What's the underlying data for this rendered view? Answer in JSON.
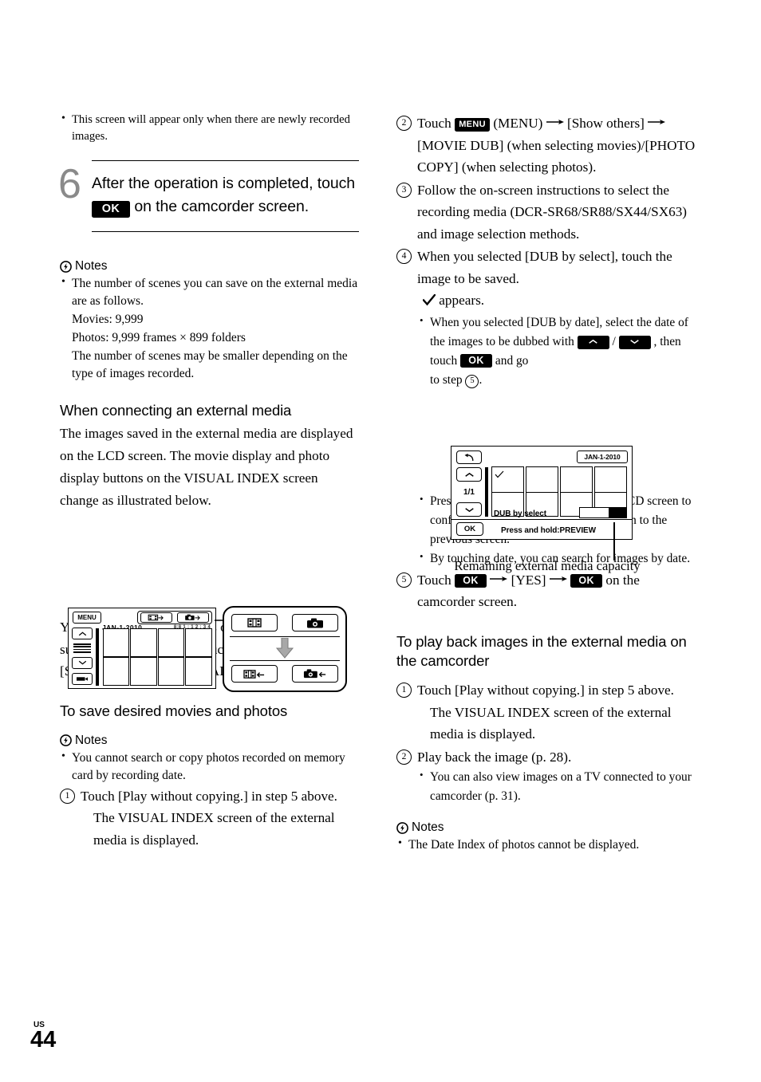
{
  "page": {
    "locale_tag": "US",
    "number": "44"
  },
  "left_column": {
    "intro_bullets": [
      "This screen will appear only when there are newly recorded images."
    ],
    "step": {
      "number": "6",
      "text_before": "After the operation is completed, touch",
      "key_label": "OK",
      "text_after": "on the camcorder screen."
    },
    "notes1": {
      "heading": "Notes",
      "icon": "lightning-circle-icon",
      "bullets": [
        "The number of scenes you can save on the external media are as follows.",
        "Movies: 9,999",
        "Photos: 9,999 frames × 899 folders",
        "The number of scenes may be smaller depending on the type of images recorded."
      ]
    },
    "section1": {
      "heading": "When connecting an external media",
      "paragraph": "The images saved in the external media are displayed on the LCD screen. The movie display and photo display buttons on the VISUAL INDEX screen change as illustrated below."
    },
    "lcd_figure": {
      "menu_button": "MENU",
      "date": "JAN-1-2010",
      "time": "8:8 1 : 1 2 : 3 4",
      "tab_movie_icon": "film-usb-icon",
      "tab_photo_icon": "camera-usb-icon",
      "up_icon": "chevron-up-icon",
      "down_icon": "chevron-down-icon",
      "list_icon": "list-lines-icon",
      "bottom_icon": "movie-roll-icon",
      "callout": {
        "top_movie_icon": "film-icon",
        "top_photo_icon": "camera-icon",
        "transition_icon": "arrow-down-icon",
        "bottom_movie_icon": "film-usb-icon",
        "bottom_photo_icon": "camera-usb-icon"
      }
    },
    "section1_after": {
      "text_before": "You can make menu settings of the external media such as deleting images. Touch",
      "key_label": "MENU",
      "text_after": "(MENU)",
      "arrow": "arrow-right-icon",
      "text_end": "[Show others] on the VISUAL INDEX screen."
    },
    "section2": {
      "heading": "To save desired movies and photos",
      "notes": {
        "heading": "Notes",
        "icon": "lightning-circle-icon",
        "bullets": [
          "You cannot search or copy photos recorded on memory card by recording date."
        ]
      },
      "steps": [
        {
          "num": "1",
          "text": "Touch [Play without copying.] in step 5 above.",
          "detail": "The VISUAL INDEX screen of the external media is displayed."
        }
      ]
    }
  },
  "right_column": {
    "steps": [
      {
        "num": "2",
        "text_before": "Touch",
        "key_label": "MENU",
        "text_mid1": "(MENU)",
        "text_mid2": "[Show others]",
        "text_mid3": "[MOVIE DUB] (when selecting movies)/[PHOTO COPY] (when selecting photos)."
      },
      {
        "num": "3",
        "text": "Follow the on-screen instructions to select the recording media (DCR-SR68/SR88/SX44/SX63) and image selection methods."
      },
      {
        "num": "4",
        "text": "When you selected [DUB by select], touch the image to be saved.",
        "detail_check_icon": "checkmark-icon",
        "detail": "appears.",
        "sub_bullet_before": "When you selected [DUB by date], select the date of the images to be dubbed with",
        "key_up": "chevron-up-icon",
        "key_down": "chevron-down-icon",
        "sub_bullet_mid": ", then touch",
        "key_ok": "OK",
        "sub_bullet_after": "and go",
        "sub_bullet_end_before": "to step",
        "sub_bullet_step": "5",
        "sub_bullet_end_after": "."
      }
    ],
    "dub_figure": {
      "back_icon": "back-arrow-icon",
      "date_badge": "JAN-1-2010",
      "up_icon": "chevron-up-icon",
      "down_icon": "chevron-down-icon",
      "page_indicator": "1/1",
      "check_icon": "checkmark-icon",
      "mode_label": "DUB by select",
      "ok_label": "OK",
      "hint_label": "Press and hold:PREVIEW",
      "capacity_bar": "remaining-capacity-bar"
    },
    "figure_caption": "Remaining external media capacity",
    "after_figure_bullets": [
      {
        "text_before": "Press and hold the image down on the LCD screen to confirm the image. Touch",
        "key_back_icon": "back-arrow-icon",
        "text_after": "to return to the previous screen."
      },
      {
        "text_before": "By touching date, you can search for images by date.",
        "key_back_icon": "",
        "text_after": ""
      }
    ],
    "step5": {
      "num": "5",
      "text_before": "Touch",
      "key_ok1": "OK",
      "text_mid": "[YES]",
      "key_ok2": "OK",
      "text_after": "on the camcorder screen."
    },
    "section3": {
      "heading": "To play back images in the external media on the camcorder",
      "steps": [
        {
          "num": "1",
          "text": "Touch [Play without copying.] in step 5 above.",
          "detail": "The VISUAL INDEX screen of the external media is displayed."
        },
        {
          "num": "2",
          "text": "Play back the image (p. 28).",
          "bullet": "You can also view images on a TV connected to your camcorder (p. 31)."
        }
      ]
    },
    "notes_final": {
      "heading": "Notes",
      "icon": "lightning-circle-icon",
      "bullets": [
        "The Date Index of photos cannot be displayed."
      ]
    }
  }
}
